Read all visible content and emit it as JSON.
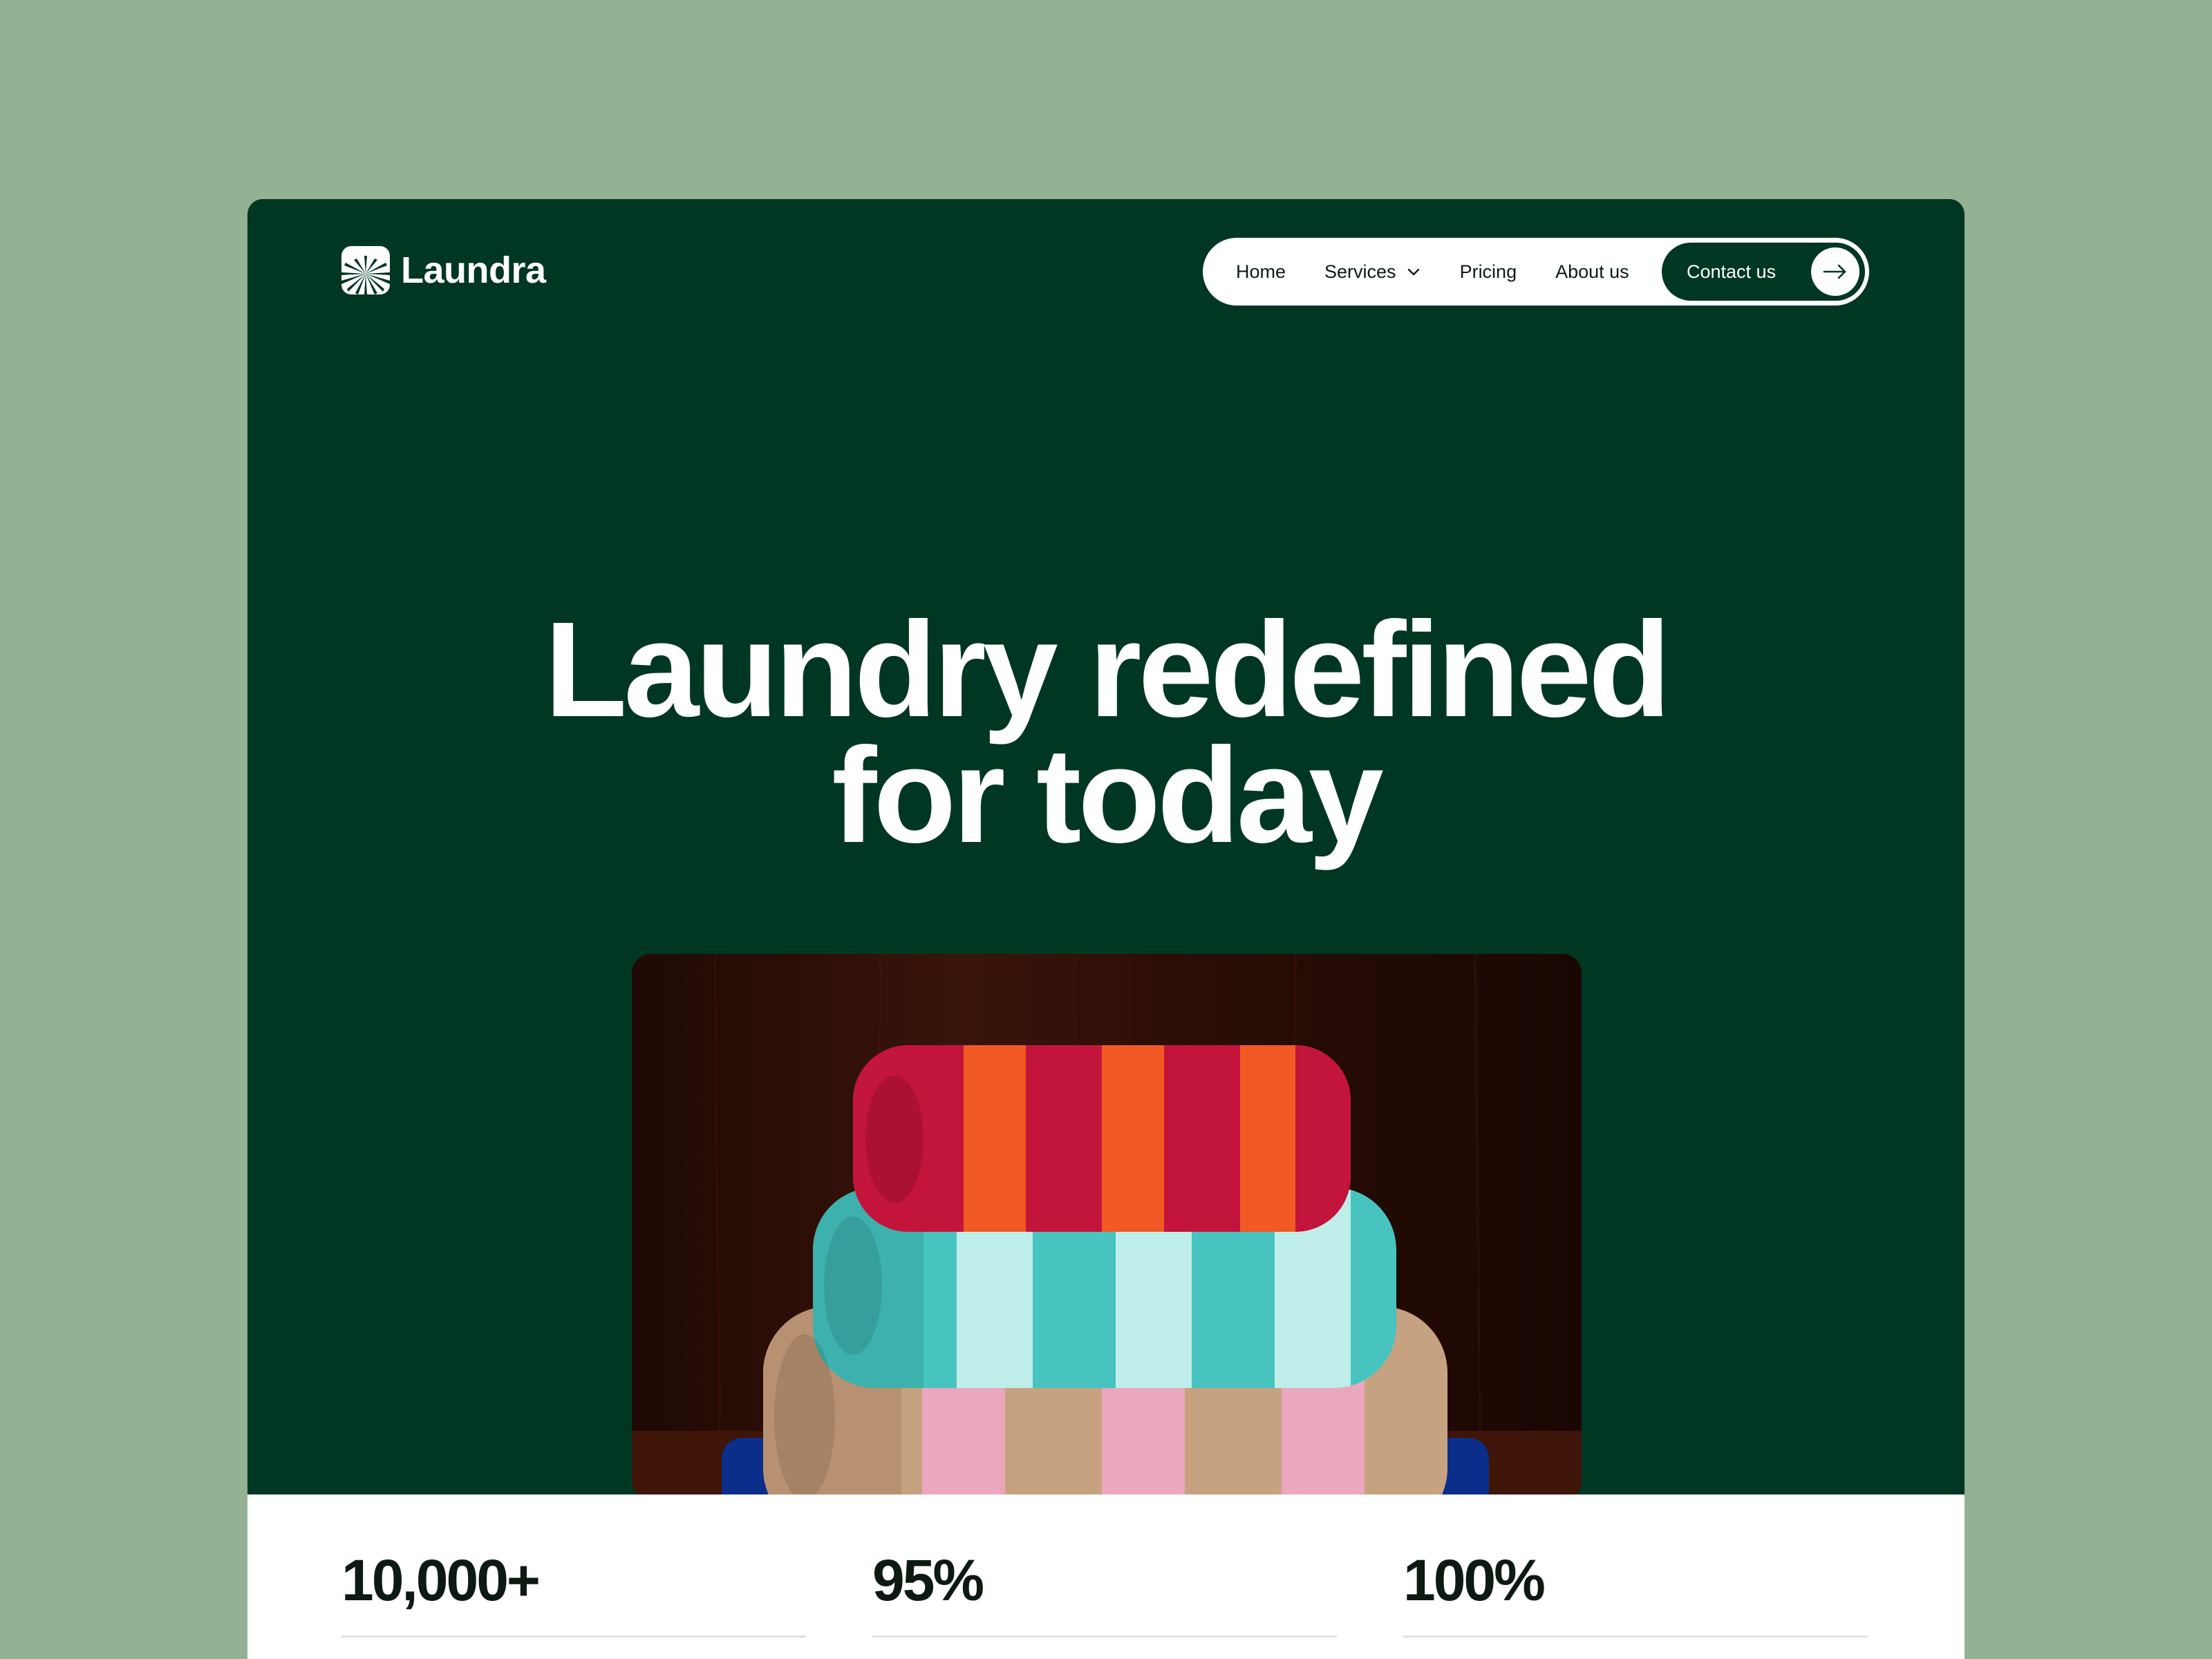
{
  "brand": {
    "name": "Laundra"
  },
  "nav": {
    "items": [
      {
        "label": "Home"
      },
      {
        "label": "Services"
      },
      {
        "label": "Pricing"
      },
      {
        "label": "About us"
      }
    ],
    "contact_label": "Contact us"
  },
  "hero": {
    "title_line1": "Laundry redefined",
    "title_line2": "for today"
  },
  "stats": [
    {
      "value": "10,000+"
    },
    {
      "value": "95%"
    },
    {
      "value": "100%"
    }
  ],
  "colors": {
    "page_bg": "#92b293",
    "brand_green": "#003723",
    "white": "#ffffff"
  }
}
